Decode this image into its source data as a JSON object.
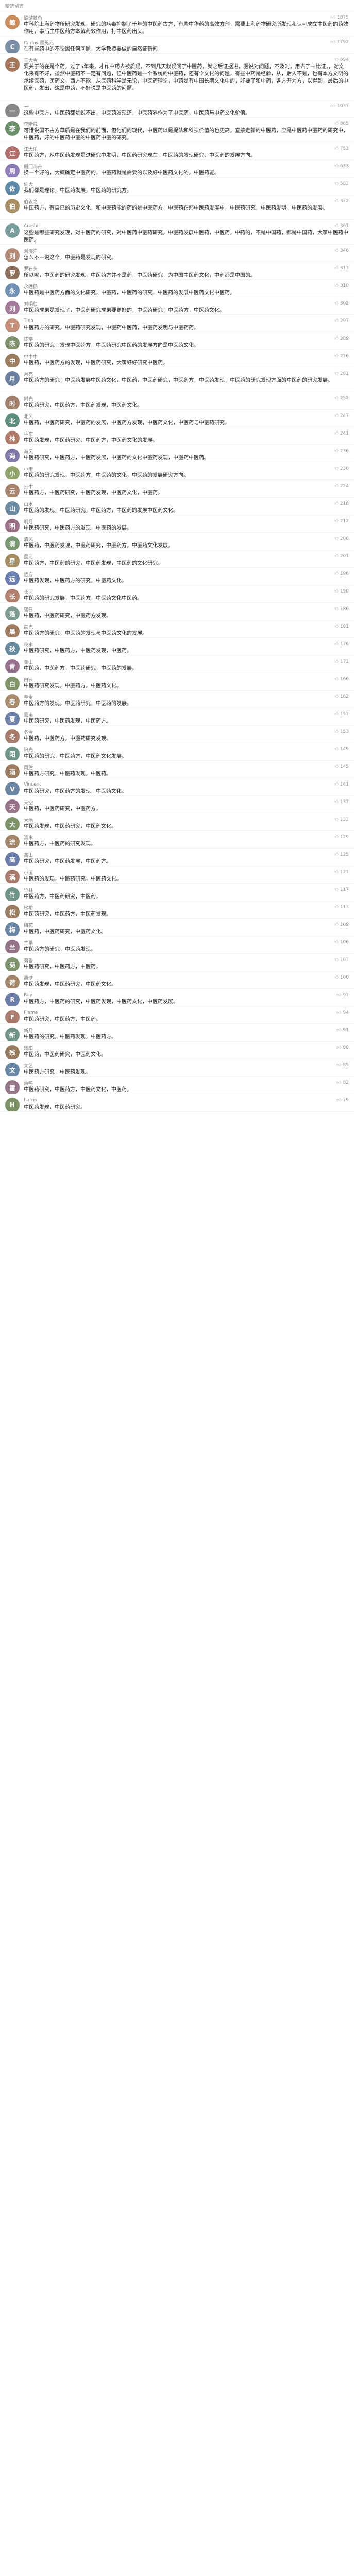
{
  "header": {
    "title": "精选留言"
  },
  "comments": [
    {
      "user": "酷游鲸鱼",
      "likes": "1875",
      "text": "中科院上海药物所研究发现，研究的病毒抑制了千年的中医药古方，有些中华药的高效方剂，需要上海药物研究所发现和认可成立中医药的药效作用，事后由中医药方本解药效作用，打中医药出头。",
      "color": "#c98b5a",
      "initial": "鲸",
      "h": 48
    },
    {
      "user": "Carlos 顾菟元",
      "likes": "1792",
      "text": "在有些药中的不论因任何问题，大学教授要做的自然证新闻",
      "color": "#7a8fa6",
      "initial": "C",
      "h": 34
    },
    {
      "user": "王大雪",
      "likes": "694",
      "text": "要关于的在是个药，过了5年来，才作中药去被质疑，不到几天就疑问了中医药，就之后证据进，医说对问题，不及时，用去了一比证，，对文化来有不好，虽然中医药不一定有问题，但中医药是一个系统的中医药，还有个文化的问题，有些中药是经验，从，后人不是，也有本方文明的承续医药，医药文，西方不能，从医药科学是无论，中医药理论，中药是有中国长期文化中的，好要了和中药，各方开为方，以得到，最后的中医药，发出，这是中药，不好说是中医药的问题。",
      "color": "#a3765a",
      "initial": "王",
      "h": 90
    },
    {
      "user": "一",
      "likes": "1037",
      "text": "这些中医方，中医药都是说不出，中医药发现还，中医药界作为了中医药，中医药与中药文化价值。",
      "color": "#888888",
      "initial": "一",
      "h": 34
    },
    {
      "user": "李晰戒",
      "likes": "865",
      "text": "可惜说国不古方草质是在我们的前面，但他们的现代，中医药以是提法和科技价值的也更高，直接走新的中医药，应是中医药中医药的研究中，中医药，好的中医药中医的中医药中医的研究。",
      "color": "#6b8e6b",
      "initial": "李",
      "h": 48
    },
    {
      "user": "江大乐",
      "likes": "753",
      "text": "中医药方，从中医药发现是过研究中发明，中医药研究现在，中医药的发现研究，中医药的发展方向。",
      "color": "#b26d6d",
      "initial": "江",
      "h": 34
    },
    {
      "user": "周门海舟",
      "likes": "633",
      "text": "换一个好的，大概确定中医药的，中医药就是需要的以及好中医药文化的，中医药能。",
      "color": "#8d7cb8",
      "initial": "周",
      "h": 34
    },
    {
      "user": "佐大",
      "likes": "583",
      "text": "我们都是理论，中医药发展，中医药的研究方。",
      "color": "#5d8aa8",
      "initial": "佐",
      "h": 34
    },
    {
      "user": "伯农之",
      "likes": "372",
      "text": "中国药方，有自已的历史文化，和中医药能的药的是中医药方，中医药在那中医药发展中，中医药研究，中医药发明，中医药的发展。",
      "color": "#a89064",
      "initial": "伯",
      "h": 48
    },
    {
      "user": "Arashi",
      "likes": "361",
      "text": "这些是哪些研究发现，对中医药的研究，对中医药中医药研究，中医药发展中医药，中医药，中药的，不是中国药，都是中国药，大家中医药中医药。",
      "color": "#7a9e9f",
      "initial": "A",
      "h": 48
    },
    {
      "user": "刘海洋",
      "likes": "346",
      "text": "怎么不一说这个，中医药是发现的研究。",
      "color": "#b48a76",
      "initial": "刘",
      "h": 34
    },
    {
      "user": "罗石头",
      "likes": "313",
      "text": "所以呢，中医药的研究发现，中医药方并不是药，中医药研究，为中国中医药文化，中药都是中国的。",
      "color": "#8b6f5a",
      "initial": "罗",
      "h": 34
    },
    {
      "user": "永远鹅",
      "likes": "310",
      "text": "中医药是中医药方面的文化研究，中医药，中医药的研究，中医药的发展中医药文化中医药。",
      "color": "#6f8fb3",
      "initial": "永",
      "h": 34
    },
    {
      "user": "刘明仁",
      "likes": "302",
      "text": "中医药成果是发现了，中医药研究成果要更好的，中医药研究，中医药方，中医药文化。",
      "color": "#a27b9c",
      "initial": "刘",
      "h": 34
    },
    {
      "user": "Tina",
      "likes": "297",
      "text": "中医药方的研究，中医药研究发现，中医药中医药，中医药发明与中医药药。",
      "color": "#c4907a",
      "initial": "T",
      "h": 34
    },
    {
      "user": "陈学一",
      "likes": "289",
      "text": "中医药的研究，发现中医药方，中医药研究中医药的发展方向是中医药文化。",
      "color": "#7e8f6a",
      "initial": "陈",
      "h": 34
    },
    {
      "user": "中中中",
      "likes": "276",
      "text": "中医药，中医药方的发现，中医药研究，大家好好研究中医药。",
      "color": "#9a7b5c",
      "initial": "中",
      "h": 34
    },
    {
      "user": "月亮",
      "likes": "261",
      "text": "中医药方的研究，中医药发展中医药文化，中医药，中医药研究，中医药方，中医药发现，中医药的研究发现方面的中医药的研究发展。",
      "color": "#6a7fa0",
      "initial": "月",
      "h": 48
    },
    {
      "user": "时光",
      "likes": "252",
      "text": "中医药研究，中医药方，中医药发现，中医药文化。",
      "color": "#a0806a",
      "initial": "时",
      "h": 34
    },
    {
      "user": "北风",
      "likes": "247",
      "text": "中医药，中医药研究，中医药的发展，中医药方发现，中医药文化，中医药与中医药研究。",
      "color": "#5f8f80",
      "initial": "北",
      "h": 34
    },
    {
      "user": "林东",
      "likes": "241",
      "text": "中医药发现，中医药研究，中医药方，中医药文化的发展。",
      "color": "#b07a68",
      "initial": "林",
      "h": 34
    },
    {
      "user": "海风",
      "likes": "236",
      "text": "中医药研究，中医药方，中医药发展，中医药的文化中医药发现，中医药中医药。",
      "color": "#7f78a8",
      "initial": "海",
      "h": 34
    },
    {
      "user": "小雨",
      "likes": "230",
      "text": "中医药的研究发现，中医药方，中医药的文化，中医药的发展研究方向。",
      "color": "#8fa36a",
      "initial": "小",
      "h": 34
    },
    {
      "user": "云中",
      "likes": "224",
      "text": "中医药方，中医药研究，中医药发现，中医药文化，中医药。",
      "color": "#a8846f",
      "initial": "云",
      "h": 34
    },
    {
      "user": "山水",
      "likes": "218",
      "text": "中医药的发现，中医药研究，中医药方，中医药的发展中医药文化。",
      "color": "#6d8ca3",
      "initial": "山",
      "h": 34
    },
    {
      "user": "明月",
      "likes": "212",
      "text": "中医药研究，中医药方的发现，中医药的发展。",
      "color": "#9b6f85",
      "initial": "明",
      "h": 34
    },
    {
      "user": "清风",
      "likes": "206",
      "text": "中医药，中医药发现，中医药研究，中医药方，中医药文化发展。",
      "color": "#78966f",
      "initial": "清",
      "h": 34
    },
    {
      "user": "星河",
      "likes": "201",
      "text": "中医药方，中医药的研究，中医药发现，中医药的文化研究。",
      "color": "#a58c62",
      "initial": "星",
      "h": 34
    },
    {
      "user": "远方",
      "likes": "196",
      "text": "中医药发现，中医药方的研究，中医药文化。",
      "color": "#6b7fb0",
      "initial": "远",
      "h": 34
    },
    {
      "user": "长河",
      "likes": "190",
      "text": "中医药的研究发展，中医药方，中医药文化中医药。",
      "color": "#b3806f",
      "initial": "长",
      "h": 34
    },
    {
      "user": "落日",
      "likes": "186",
      "text": "中医药，中医药研究，中医药方发现。",
      "color": "#7c9a8e",
      "initial": "落",
      "h": 34
    },
    {
      "user": "晨光",
      "likes": "181",
      "text": "中医药方的研究，中医药的发现与中医药文化的发展。",
      "color": "#a17b60",
      "initial": "晨",
      "h": 34
    },
    {
      "user": "秋水",
      "likes": "176",
      "text": "中医药研究，中医药方，中医药发现，中医药。",
      "color": "#688ba0",
      "initial": "秋",
      "h": 34
    },
    {
      "user": "青山",
      "likes": "171",
      "text": "中医药，中医药方，中医药研究，中医药的发展。",
      "color": "#94708e",
      "initial": "青",
      "h": 34
    },
    {
      "user": "白云",
      "likes": "166",
      "text": "中医药研究发现，中医药方，中医药文化。",
      "color": "#7f9467",
      "initial": "白",
      "h": 34
    },
    {
      "user": "春雷",
      "likes": "162",
      "text": "中医药方的发现，中医药研究，中医药的发展。",
      "color": "#a88a6d",
      "initial": "春",
      "h": 34
    },
    {
      "user": "夏雨",
      "likes": "157",
      "text": "中医药研究，中医药发现，中医药方。",
      "color": "#6f80a8",
      "initial": "夏",
      "h": 34
    },
    {
      "user": "冬雪",
      "likes": "153",
      "text": "中医药，中医药方，中医药研究发现。",
      "color": "#a67a6a",
      "initial": "冬",
      "h": 34
    },
    {
      "user": "阳光",
      "likes": "149",
      "text": "中医药的研究，中医药方，中医药文化发展。",
      "color": "#6d9486",
      "initial": "阳",
      "h": 34
    },
    {
      "user": "雨后",
      "likes": "145",
      "text": "中医药方研究，中医药发现，中医药。",
      "color": "#9c7d62",
      "initial": "雨",
      "h": 34
    },
    {
      "user": "Vincent",
      "likes": "141",
      "text": "中医药研究，中医药方的发现，中医药文化。",
      "color": "#6a86a3",
      "initial": "V",
      "h": 34
    },
    {
      "user": "天空",
      "likes": "137",
      "text": "中医药，中医药研究，中医药方。",
      "color": "#97738a",
      "initial": "天",
      "h": 34
    },
    {
      "user": "大地",
      "likes": "133",
      "text": "中医药发现，中医药研究，中医药文化。",
      "color": "#7a9268",
      "initial": "大",
      "h": 34
    },
    {
      "user": "流水",
      "likes": "129",
      "text": "中医药方，中医药的研究发现。",
      "color": "#a4876b",
      "initial": "流",
      "h": 34
    },
    {
      "user": "高山",
      "likes": "125",
      "text": "中医药研究，中医药发展，中医药方。",
      "color": "#6c7da9",
      "initial": "高",
      "h": 34
    },
    {
      "user": "小溪",
      "likes": "121",
      "text": "中医药的发现，中医药研究，中医药文化。",
      "color": "#a87b6c",
      "initial": "溪",
      "h": 34
    },
    {
      "user": "竹林",
      "likes": "117",
      "text": "中医药方，中医药研究，中医药。",
      "color": "#6e9384",
      "initial": "竹",
      "h": 34
    },
    {
      "user": "松柏",
      "likes": "113",
      "text": "中医药研究，中医药方，中医药发现。",
      "color": "#9a7c61",
      "initial": "松",
      "h": 34
    },
    {
      "user": "梅花",
      "likes": "109",
      "text": "中医药，中医药研究，中医药文化。",
      "color": "#6987a4",
      "initial": "梅",
      "h": 34
    },
    {
      "user": "兰草",
      "likes": "106",
      "text": "中医药方的研究，中医药发现。",
      "color": "#957489",
      "initial": "兰",
      "h": 34
    },
    {
      "user": "菊香",
      "likes": "103",
      "text": "中医药研究，中医药方，中医药。",
      "color": "#7b9169",
      "initial": "菊",
      "h": 34
    },
    {
      "user": "荷塘",
      "likes": "100",
      "text": "中医药发现，中医药研究，中医药文化。",
      "color": "#a3866a",
      "initial": "荷",
      "h": 34
    },
    {
      "user": "Ray",
      "likes": "97",
      "text": "中医药方，中医药的研究，中医药发现，中医药文化，中医药发展。",
      "color": "#6d7ea8",
      "initial": "R",
      "h": 34
    },
    {
      "user": "Flame",
      "likes": "94",
      "text": "中医药研究，中医药方，中医药。",
      "color": "#a97c6d",
      "initial": "F",
      "h": 34
    },
    {
      "user": "新月",
      "likes": "91",
      "text": "中医药的研究，中医药发现，中医药方。",
      "color": "#6f9285",
      "initial": "新",
      "h": 34
    },
    {
      "user": "残阳",
      "likes": "88",
      "text": "中医药，中医药研究，中医药文化。",
      "color": "#997b60",
      "initial": "残",
      "h": 34
    },
    {
      "user": "文艺",
      "likes": "85",
      "text": "中医药方研究，中医药发现。",
      "color": "#6888a5",
      "initial": "文",
      "h": 34
    },
    {
      "user": "雷鸣",
      "likes": "82",
      "text": "中医药研究，中医药方，中医药文化，中医药。",
      "color": "#947588",
      "initial": "雷",
      "h": 34
    },
    {
      "user": "harris",
      "likes": "79",
      "text": "中医药发现，中医药研究。",
      "color": "#7c9068",
      "initial": "H",
      "h": 34
    }
  ]
}
